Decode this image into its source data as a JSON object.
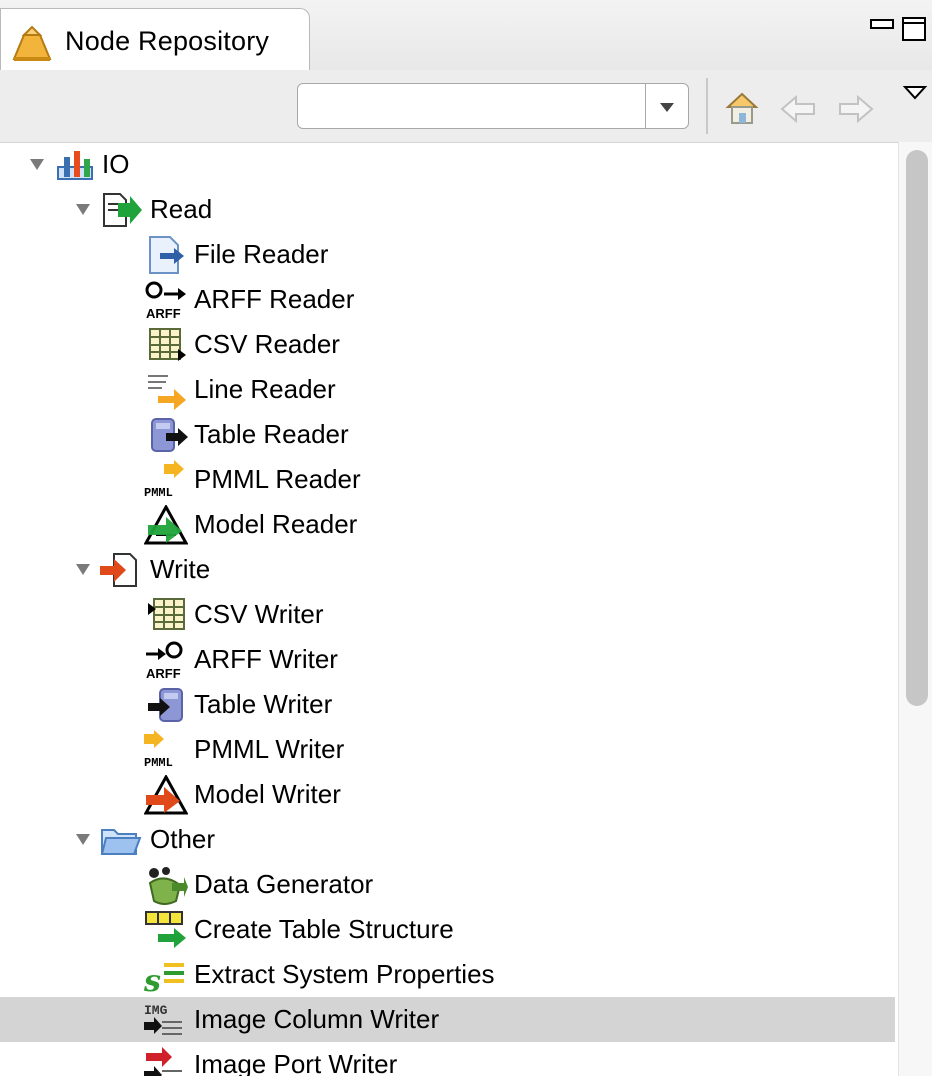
{
  "view": {
    "tab_title": "Node Repository",
    "icon": "knime-node-repository-icon"
  },
  "toolbar": {
    "search_value": "",
    "search_placeholder": ""
  },
  "tree": {
    "io": "IO",
    "read": {
      "label": "Read",
      "items": [
        "File Reader",
        "ARFF Reader",
        "CSV Reader",
        "Line Reader",
        "Table Reader",
        "PMML Reader",
        "Model Reader"
      ]
    },
    "write": {
      "label": "Write",
      "items": [
        "CSV Writer",
        "ARFF Writer",
        "Table Writer",
        "PMML Writer",
        "Model Writer"
      ]
    },
    "other": {
      "label": "Other",
      "items": [
        "Data Generator",
        "Create Table Structure",
        "Extract System Properties",
        "Image Column Writer",
        "Image Port Writer"
      ],
      "selected": "Image Column Writer"
    }
  },
  "colors": {
    "selection": "#d4d4d4",
    "read_arrow": "#1fa33a",
    "write_arrow": "#e04a1a",
    "orange_arrow": "#f5a623"
  }
}
